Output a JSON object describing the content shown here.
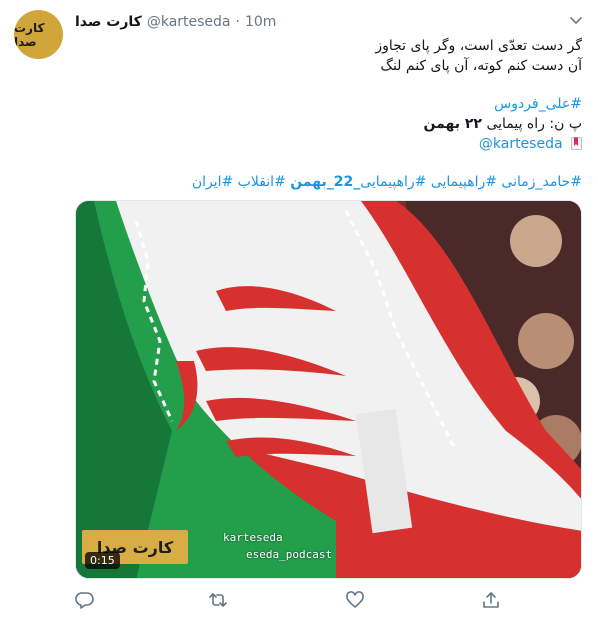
{
  "tweet": {
    "display_name": "کارت صدا",
    "handle": "@karteseda",
    "dot": "·",
    "time": "10m",
    "avatar_text": "کارت صدا",
    "lines": [
      "گر دست تعدّی است، وگر پای تجاوز",
      "آن دست کنم کوته، آن پای کنم لنگ"
    ],
    "poet_hashtag": "#علی_فردوس",
    "credit_prefix": "پ ن: راه پیمایی",
    "credit_bold": "۲۲ بهمن",
    "mention": "@karteseda",
    "tags_before": "#حامد_زمانی #راهپیمایی #راهپیمایی",
    "tags_bold": "_22_بهمن",
    "tags_after": "#انقلاب #ایران"
  },
  "media": {
    "duration": "0:15",
    "badge_text": "کارت صدا",
    "overlay_1": "karteseda",
    "overlay_2": "eseda_podcast"
  },
  "actions": {
    "reply": "reply-icon",
    "retweet": "retweet-icon",
    "like": "like-icon",
    "share": "share-icon"
  },
  "colors": {
    "link": "#1b95e0",
    "muted": "#657786",
    "text": "#14171a",
    "accent_gold": "#d0a53a"
  }
}
